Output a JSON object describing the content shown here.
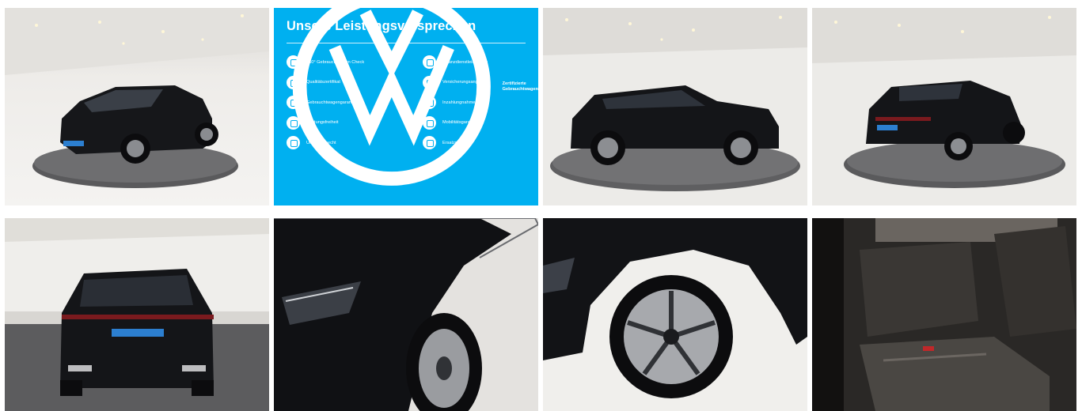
{
  "gallery": {
    "photos": [
      {
        "icon": "car-front-three-quarter"
      },
      {
        "icon": "car-side-profile"
      },
      {
        "icon": "car-rear-three-quarter"
      },
      {
        "icon": "car-rear"
      },
      {
        "icon": "headlight-fender-detail"
      },
      {
        "icon": "wheel-detail"
      },
      {
        "icon": "rear-seats-interior"
      }
    ]
  },
  "promo": {
    "title": "Unsere Leistungsversprechen",
    "features_left": [
      {
        "label": "360° Gebrauchtwagen Check",
        "icon": "check-icon"
      },
      {
        "label": "Qualitätszertifikat",
        "icon": "certificate-icon"
      },
      {
        "label": "Gebrauchtwagengarantie",
        "icon": "shield-icon"
      },
      {
        "label": "Wartungsfreiheit",
        "icon": "wrench-icon"
      },
      {
        "label": "Umtauschrecht",
        "icon": "exchange-icon"
      }
    ],
    "features_right": [
      {
        "label": "Finanzdienstleistungen",
        "icon": "finance-icon"
      },
      {
        "label": "Versicherungsangebote",
        "icon": "insurance-icon"
      },
      {
        "label": "Inzahlungnahme",
        "icon": "trade-in-icon"
      },
      {
        "label": "Mobilitätsgarantie",
        "icon": "mobility-icon"
      },
      {
        "label": "Ersatzmobilität",
        "icon": "replacement-car-icon"
      }
    ],
    "brand_line1": "Zertifizierte",
    "brand_line2": "Gebrauchtwagen",
    "colors": {
      "background": "#00b0f0",
      "text": "#ffffff"
    }
  }
}
